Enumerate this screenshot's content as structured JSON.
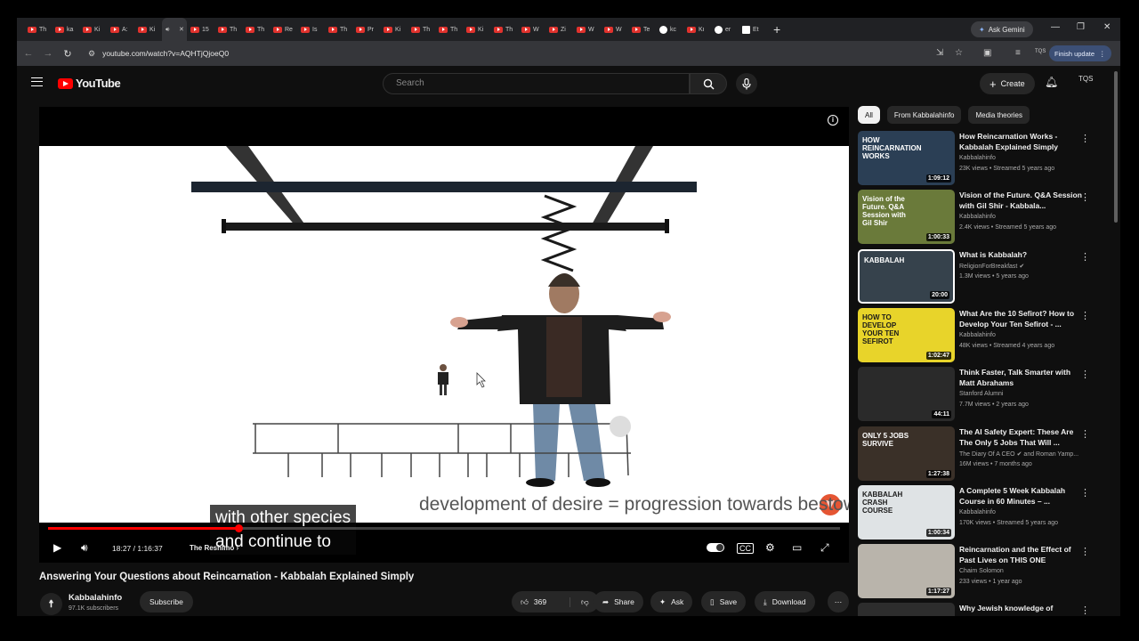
{
  "browser": {
    "tabs": [
      "Th",
      "ka",
      "Ki",
      "A:",
      "Ki",
      "",
      "15",
      "Th",
      "Th",
      "Re",
      "Is",
      "Th",
      "Pr",
      "Ki",
      "Th",
      "Th",
      "Ki",
      "Th",
      "W",
      "Zi",
      "W",
      "W",
      "Te",
      "kc",
      "Kı",
      "er",
      "Et"
    ],
    "new_tab": "+",
    "gemini_label": "Ask Gemini",
    "url": "youtube.com/watch?v=AQHTjQjoeQ0",
    "finish_update": "Finish update",
    "profile": "TQS"
  },
  "youtube": {
    "logo": "YouTube",
    "search_placeholder": "Search",
    "create": "Create",
    "avatar": "TQS"
  },
  "player": {
    "caption_lines": [
      "with other species",
      "and continue to"
    ],
    "slide_text": "development of desire = progression towards bestowal",
    "time": "18:27 / 1:16:37",
    "chapter": "The Reshimo",
    "progress": 0.241
  },
  "video": {
    "title": "Answering Your Questions about Reincarnation - Kabbalah Explained Simply",
    "channel": "Kabbalahinfo",
    "subscribers": "97.1K subscribers",
    "subscribe": "Subscribe",
    "likes": "369",
    "share": "Share",
    "ask": "Ask",
    "save": "Save",
    "download": "Download"
  },
  "chips": [
    "All",
    "From Kabbalahinfo",
    "Media theories"
  ],
  "recommendations": [
    {
      "title": "How Reincarnation Works - Kabbalah Explained Simply",
      "channel": "Kabbalahinfo",
      "meta": "23K views • Streamed 5 years ago",
      "duration": "1:09:12",
      "thumb_color": "#2b3f55",
      "thumb_text": "HOW REINCARNATION WORKS"
    },
    {
      "title": "Vision of the Future. Q&A Session with Gil Shir - Kabbala...",
      "channel": "Kabbalahinfo",
      "meta": "2.4K views • Streamed 5 years ago",
      "duration": "1:00:33",
      "thumb_color": "#6a7a3a",
      "thumb_text": "Vision of the Future. Q&A Session with Gil Shir"
    },
    {
      "title": "What is Kabbalah?",
      "channel": "ReligionForBreakfast",
      "meta": "1.3M views • 5 years ago",
      "duration": "20:00",
      "thumb_color": "#36424c",
      "thumb_text": "KABBALAH"
    },
    {
      "title": "What Are the 10 Sefirot? How to Develop Your Ten Sefirot - ...",
      "channel": "Kabbalahinfo",
      "meta": "48K views • Streamed 4 years ago",
      "duration": "1:02:47",
      "thumb_color": "#e8d42a",
      "thumb_text": "HOW TO DEVELOP YOUR TEN SEFIROT"
    },
    {
      "title": "Think Faster, Talk Smarter with Matt Abrahams",
      "channel": "Stanford Alumni",
      "meta": "7.7M views • 2 years ago",
      "duration": "44:11",
      "thumb_color": "#2a2a2a",
      "thumb_text": ""
    },
    {
      "title": "The AI Safety Expert: These Are The Only 5 Jobs That Will ...",
      "channel": "The Diary Of A CEO",
      "meta": "16M views • 7 months ago",
      "duration": "1:27:38",
      "thumb_color": "#3a3028",
      "thumb_text": "ONLY 5 JOBS SURVIVE"
    },
    {
      "title": "A Complete 5 Week Kabbalah Course in 60 Minutes – ...",
      "channel": "Kabbalahinfo",
      "meta": "170K views • Streamed 5 years ago",
      "duration": "1:00:34",
      "thumb_color": "#dfe3e5",
      "thumb_text": "KABBALAH CRASH COURSE"
    },
    {
      "title": "Reincarnation and the Effect of Past Lives on THIS ONE",
      "channel": "Chaim Solomon",
      "meta": "233 views • 1 year ago",
      "duration": "1:17:27",
      "thumb_color": "#b9b4ab",
      "thumb_text": ""
    },
    {
      "title": "Why Jewish knowledge of",
      "channel": "",
      "meta": "",
      "duration": "",
      "thumb_color": "#2d2d2d",
      "thumb_text": ""
    }
  ],
  "recommendation_extra": {
    "diary_coauthor": "and Roman Yamp..."
  }
}
